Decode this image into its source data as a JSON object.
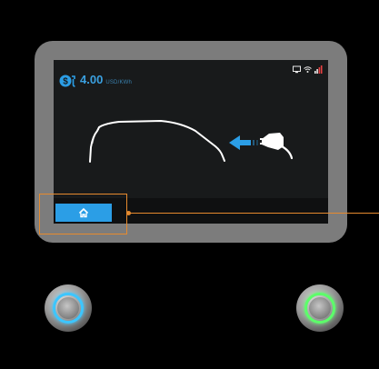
{
  "screen": {
    "price": {
      "value": "4.00",
      "unit": "USD/KWh",
      "icon": "dollar-plug-icon"
    },
    "status_icons": [
      "screen-icon",
      "wifi-icon",
      "signal-icon"
    ],
    "illustration": {
      "vehicle": "car-outline-icon",
      "arrow": "arrow-left-icon",
      "connector": "charging-plug-icon"
    },
    "bottom_bar": {
      "home_icon": "home-icon"
    }
  },
  "hardware": {
    "left_button_icon": "stop-button-icon",
    "right_button_icon": "start-button-icon"
  },
  "colors": {
    "accent": "#2b9ee6",
    "highlight": "#e68a2e",
    "left_ring": "#3cc6ff",
    "right_ring": "#5cff6a",
    "bezel": "#7c7c7c",
    "screen_bg": "#181a1b"
  }
}
